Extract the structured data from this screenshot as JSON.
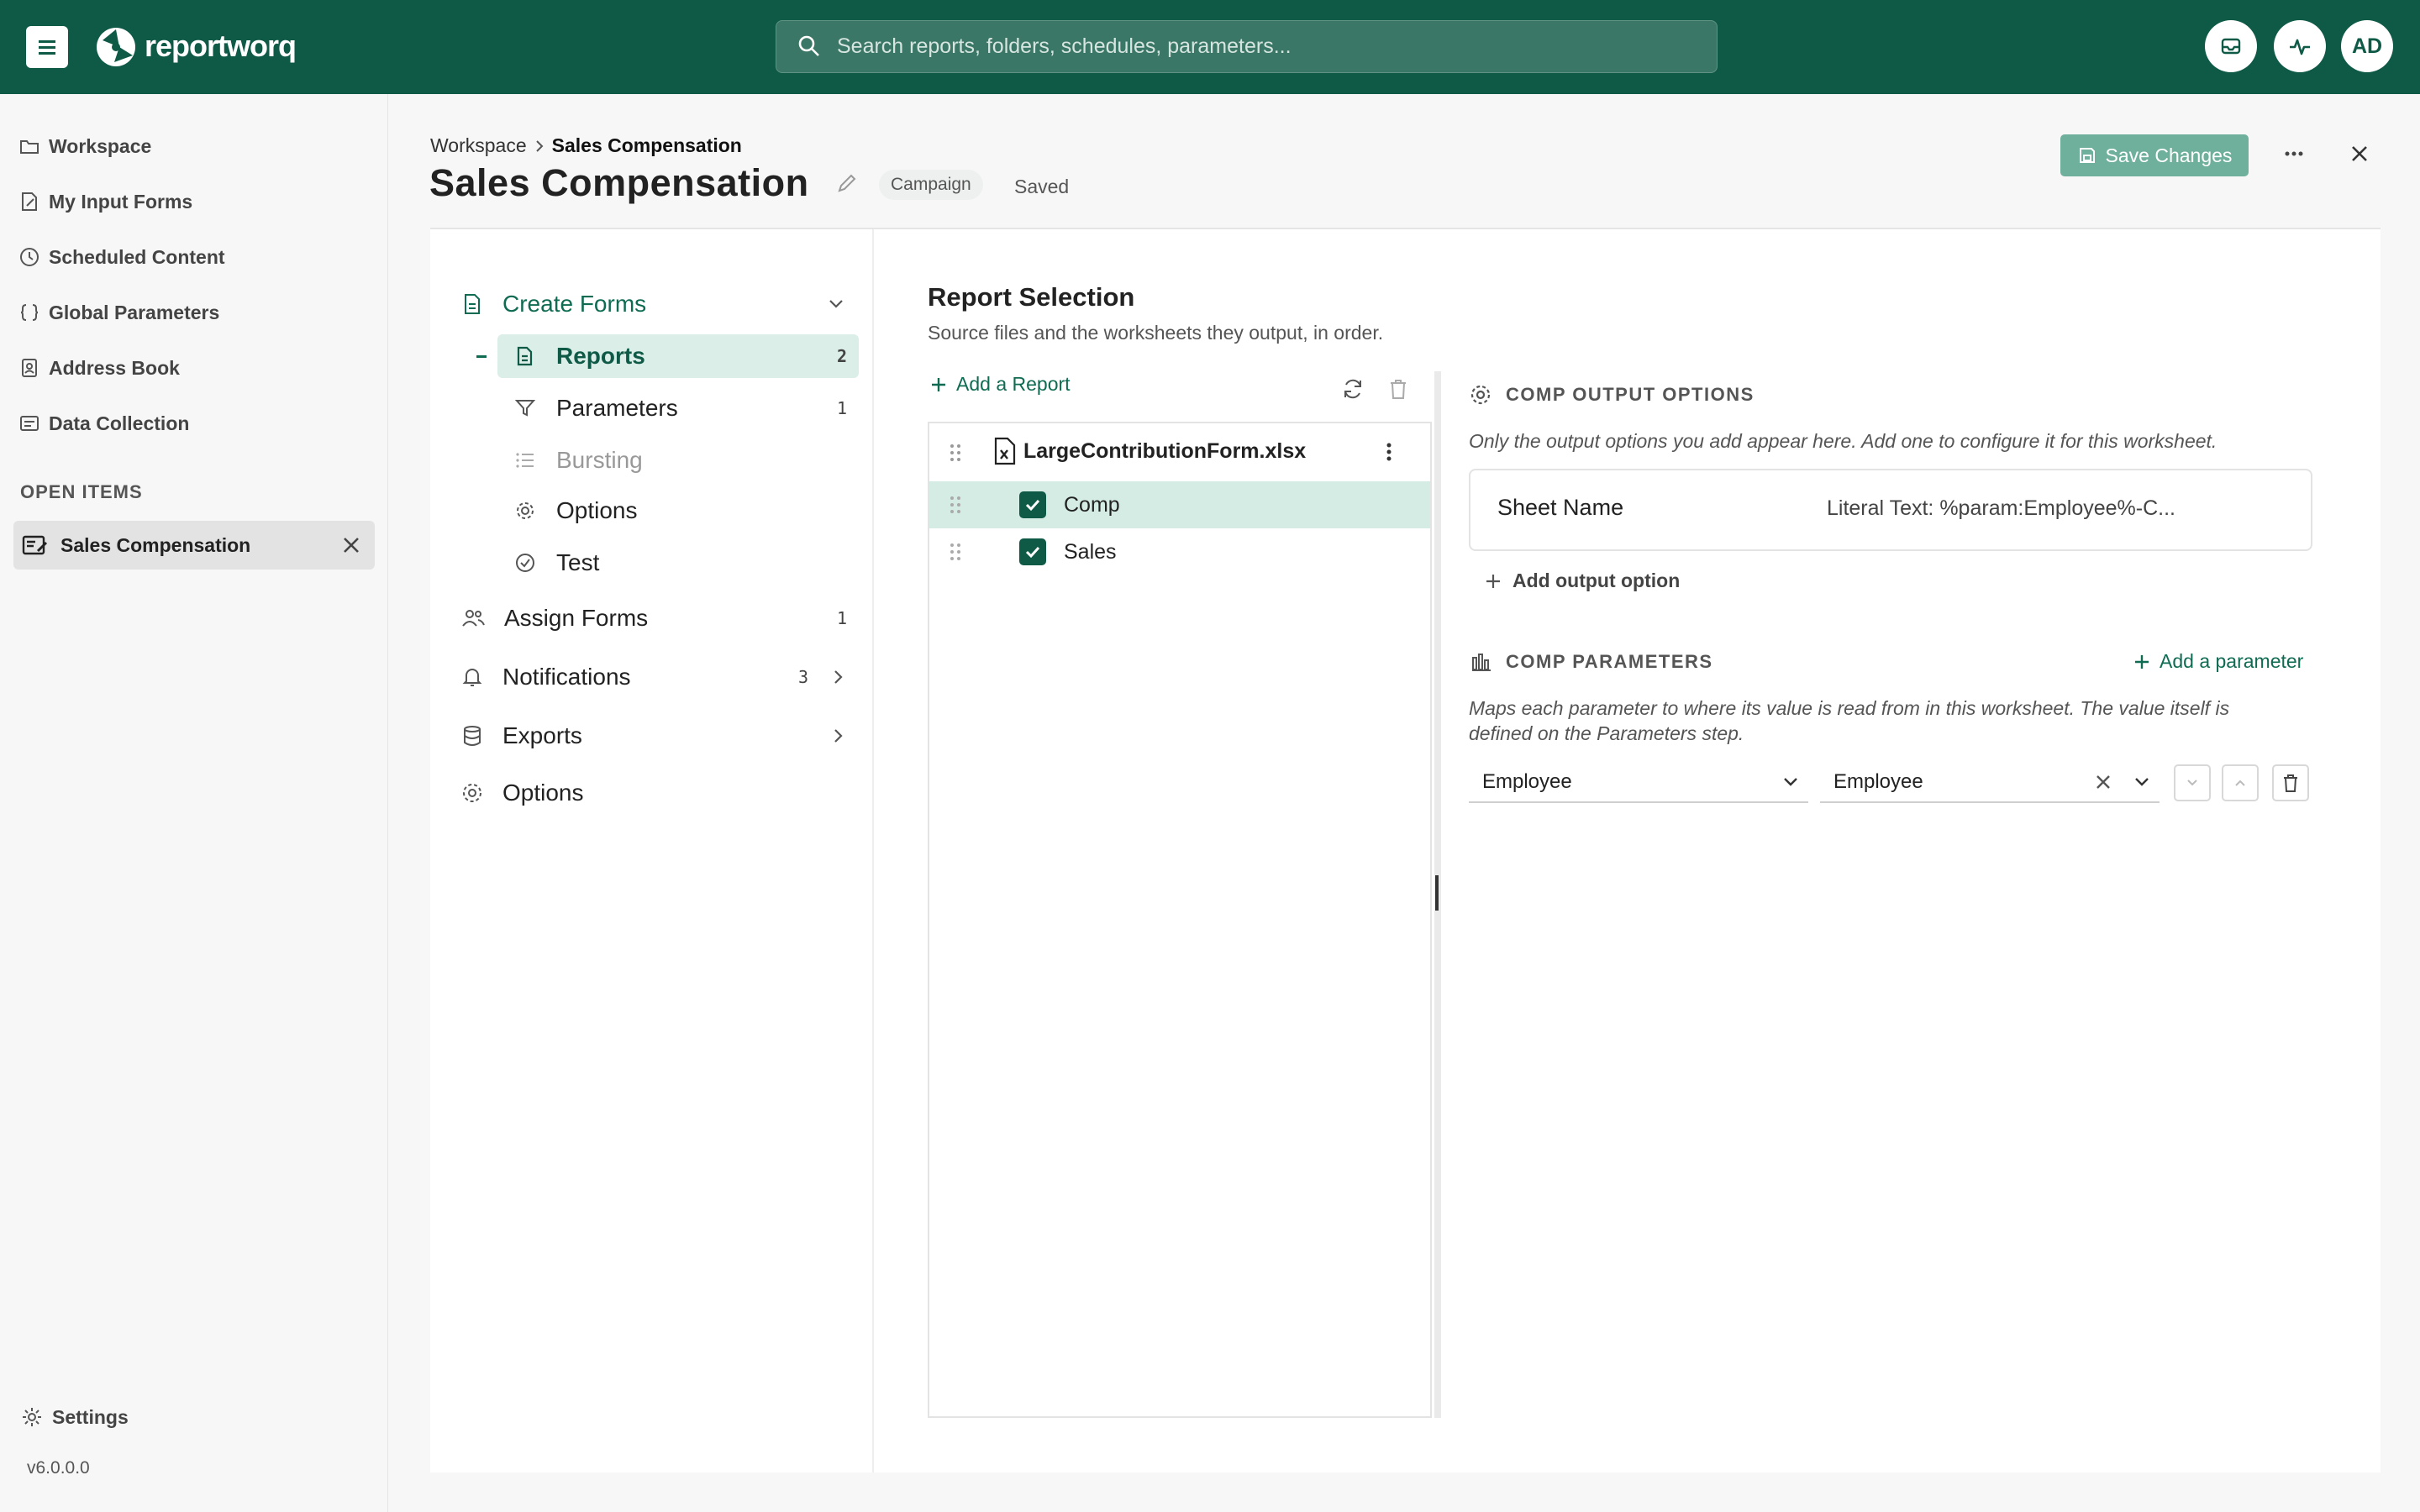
{
  "app": {
    "logo": "reportworq",
    "search_placeholder": "Search reports, folders, schedules, parameters...",
    "avatar": "AD"
  },
  "sidebar": {
    "items": [
      {
        "label": "Workspace",
        "icon": "folder-icon"
      },
      {
        "label": "My Input Forms",
        "icon": "edit-doc-icon"
      },
      {
        "label": "Scheduled Content",
        "icon": "clock-icon"
      },
      {
        "label": "Global Parameters",
        "icon": "braces-icon"
      },
      {
        "label": "Address Book",
        "icon": "contact-book-icon"
      },
      {
        "label": "Data Collection",
        "icon": "form-icon"
      }
    ],
    "open_items_label": "OPEN ITEMS",
    "open_item": "Sales Compensation",
    "settings": "Settings",
    "version": "v6.0.0.0"
  },
  "header": {
    "breadcrumb_root": "Workspace",
    "breadcrumb_current": "Sales Compensation",
    "title": "Sales Compensation",
    "badge": "Campaign",
    "status": "Saved",
    "save_label": "Save Changes"
  },
  "steps": {
    "create_forms": "Create Forms",
    "reports": {
      "label": "Reports",
      "count": "2"
    },
    "parameters": {
      "label": "Parameters",
      "count": "1"
    },
    "bursting": {
      "label": "Bursting"
    },
    "options_sub": {
      "label": "Options"
    },
    "test": {
      "label": "Test"
    },
    "assign_forms": {
      "label": "Assign Forms",
      "count": "1"
    },
    "notifications": {
      "label": "Notifications",
      "count": "3"
    },
    "exports": {
      "label": "Exports"
    },
    "options": {
      "label": "Options"
    }
  },
  "report_selection": {
    "title": "Report Selection",
    "subtitle": "Source files and the worksheets they output, in order.",
    "add_report": "Add a Report",
    "file": "LargeContributionForm.xlsx",
    "sheets": [
      "Comp",
      "Sales"
    ]
  },
  "output_options": {
    "title": "COMP OUTPUT OPTIONS",
    "hint": "Only the output options you add appear here. Add one to configure it for this worksheet.",
    "option_name": "Sheet Name",
    "option_value": "Literal Text: %param:Employee%-C...",
    "add_option": "Add output option"
  },
  "comp_parameters": {
    "title": "COMP PARAMETERS",
    "add_parameter": "Add a parameter",
    "hint_line1": "Maps each parameter to where its value is read from in this worksheet. The value itself is",
    "hint_line2": "defined on the Parameters step.",
    "parameter": "Employee",
    "source": "Employee"
  }
}
